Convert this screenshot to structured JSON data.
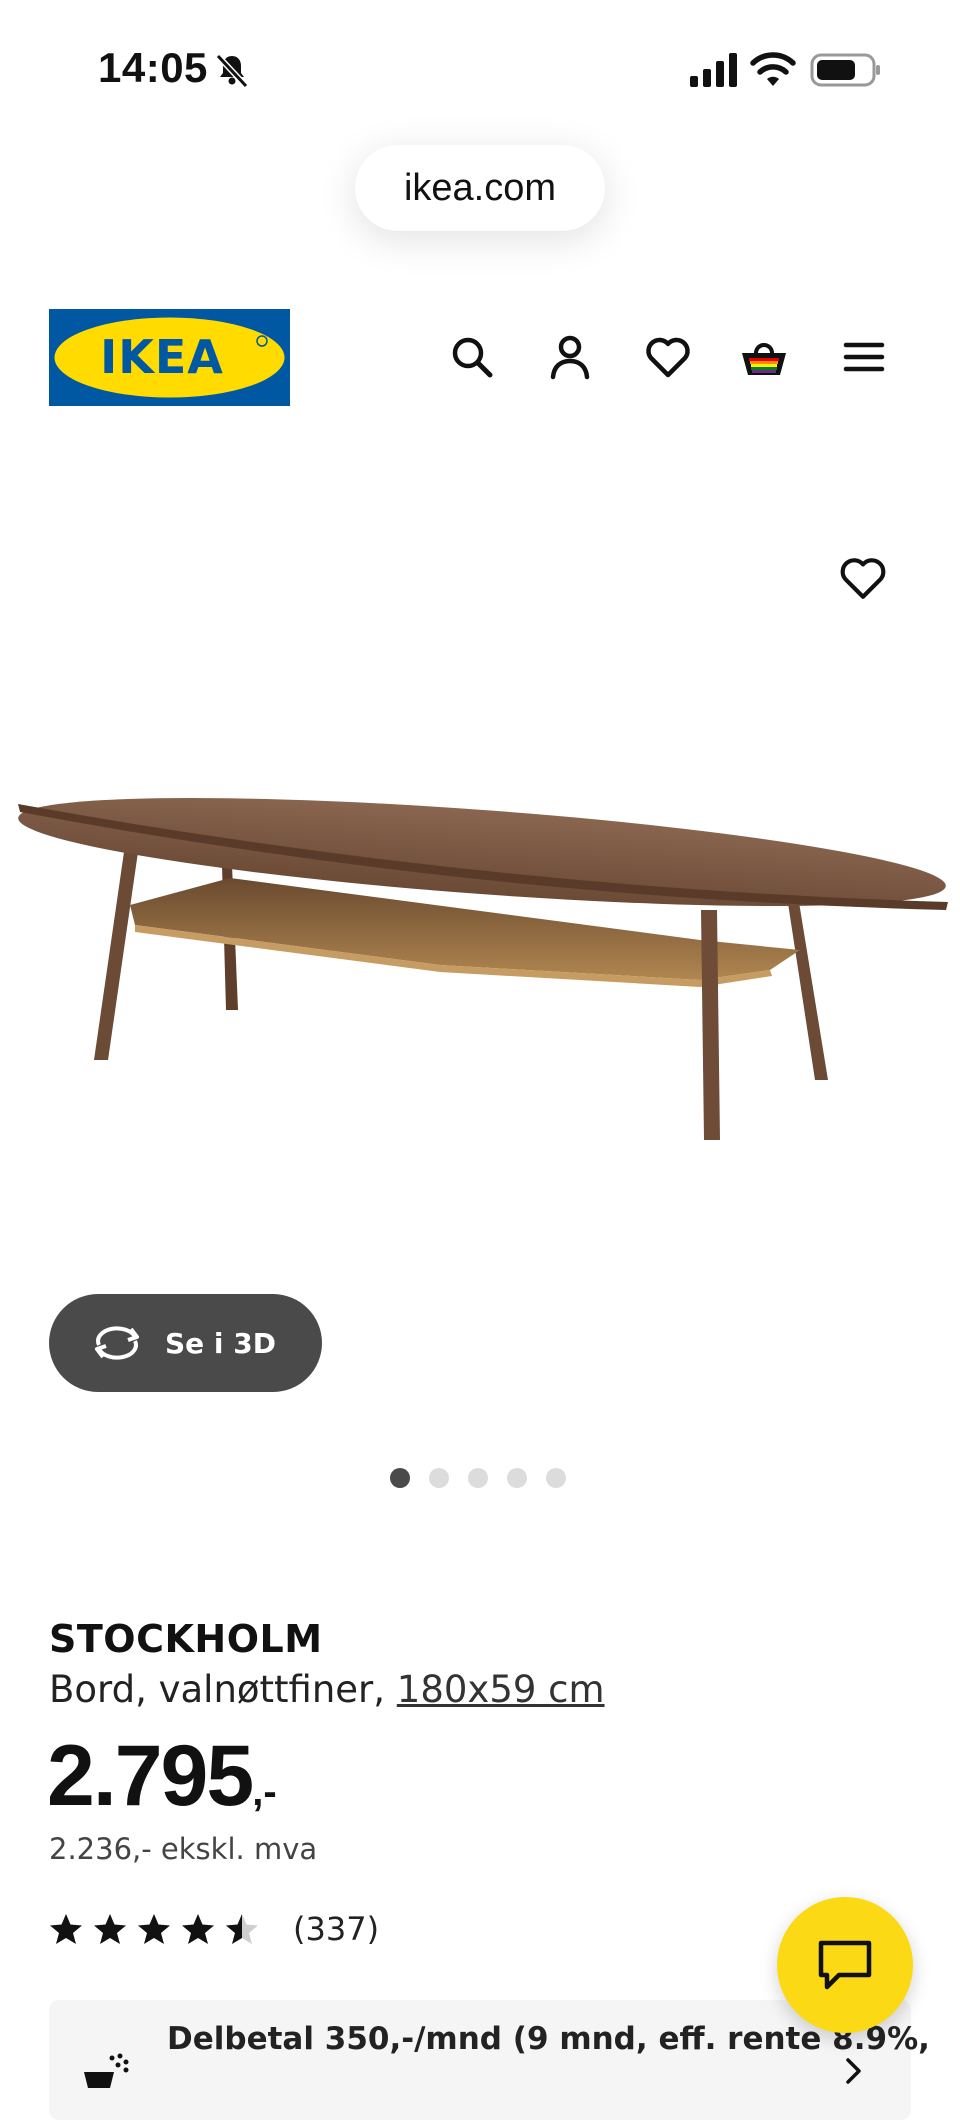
{
  "status_bar": {
    "time": "14:05"
  },
  "browser": {
    "url": "ikea.com"
  },
  "header": {
    "logo_text": "IKEA",
    "brand_colors": {
      "blue": "#0058a3",
      "yellow": "#ffdb00"
    },
    "icons": [
      "search-icon",
      "account-icon",
      "heart-icon",
      "basket-icon",
      "menu-icon"
    ]
  },
  "gallery": {
    "view_3d_label": "Se i 3D",
    "slide_count": 5,
    "active_slide": 1
  },
  "product": {
    "name": "STOCKHOLM",
    "description": "Bord, valnøttfiner, ",
    "size": "180x59 cm",
    "price": "2.795",
    "price_suffix": ",-",
    "price_excl_vat": "2.236,- ekskl. mva",
    "rating": 4.5,
    "review_count": "(337)"
  },
  "finance": {
    "text": "Delbetal 350,-/mnd (9 mnd, eff. rente 8.9%,"
  },
  "colors": {
    "chat_button": "#fbd914",
    "dark_button": "#4a4a4a"
  }
}
